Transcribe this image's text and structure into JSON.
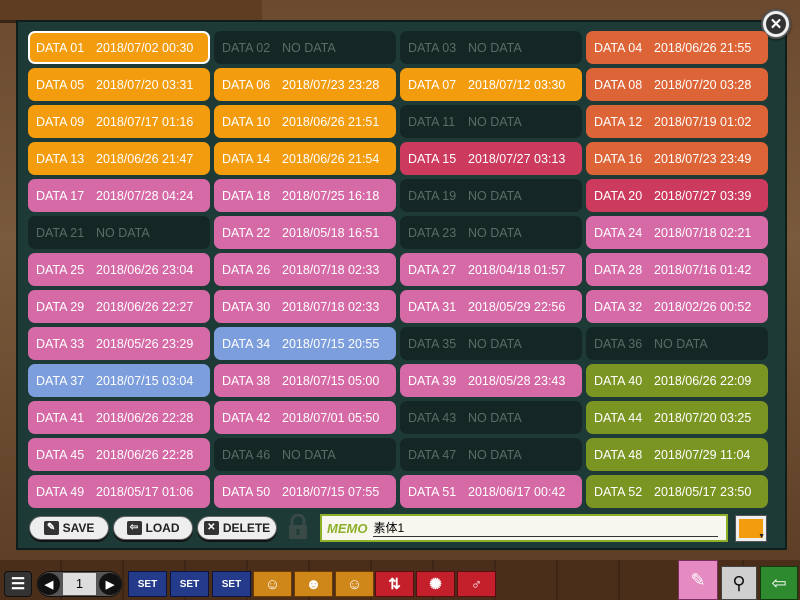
{
  "slots": [
    {
      "label": "DATA 01",
      "value": "2018/07/02  00:30",
      "color": "orange",
      "selected": true
    },
    {
      "label": "DATA 02",
      "value": "NO DATA",
      "color": "empty"
    },
    {
      "label": "DATA 03",
      "value": "NO DATA",
      "color": "empty"
    },
    {
      "label": "DATA 04",
      "value": "2018/06/26  21:55",
      "color": "redorange"
    },
    {
      "label": "DATA 05",
      "value": "2018/07/20  03:31",
      "color": "orange"
    },
    {
      "label": "DATA 06",
      "value": "2018/07/23  23:28",
      "color": "orange"
    },
    {
      "label": "DATA 07",
      "value": "2018/07/12  03:30",
      "color": "orange"
    },
    {
      "label": "DATA 08",
      "value": "2018/07/20  03:28",
      "color": "redorange"
    },
    {
      "label": "DATA 09",
      "value": "2018/07/17  01:16",
      "color": "orange"
    },
    {
      "label": "DATA 10",
      "value": "2018/06/26  21:51",
      "color": "orange"
    },
    {
      "label": "DATA 11",
      "value": "NO DATA",
      "color": "empty"
    },
    {
      "label": "DATA 12",
      "value": "2018/07/19  01:02",
      "color": "redorange"
    },
    {
      "label": "DATA 13",
      "value": "2018/06/26  21:47",
      "color": "orange"
    },
    {
      "label": "DATA 14",
      "value": "2018/06/26  21:54",
      "color": "orange"
    },
    {
      "label": "DATA 15",
      "value": "2018/07/27  03:13",
      "color": "crimson"
    },
    {
      "label": "DATA 16",
      "value": "2018/07/23  23:49",
      "color": "redorange"
    },
    {
      "label": "DATA 17",
      "value": "2018/07/28  04:24",
      "color": "pink"
    },
    {
      "label": "DATA 18",
      "value": "2018/07/25  16:18",
      "color": "pink"
    },
    {
      "label": "DATA 19",
      "value": "NO DATA",
      "color": "empty"
    },
    {
      "label": "DATA 20",
      "value": "2018/07/27  03:39",
      "color": "crimson"
    },
    {
      "label": "DATA 21",
      "value": "NO DATA",
      "color": "empty"
    },
    {
      "label": "DATA 22",
      "value": "2018/05/18  16:51",
      "color": "pink"
    },
    {
      "label": "DATA 23",
      "value": "NO DATA",
      "color": "empty"
    },
    {
      "label": "DATA 24",
      "value": "2018/07/18  02:21",
      "color": "pink"
    },
    {
      "label": "DATA 25",
      "value": "2018/06/26  23:04",
      "color": "pink"
    },
    {
      "label": "DATA 26",
      "value": "2018/07/18  02:33",
      "color": "pink"
    },
    {
      "label": "DATA 27",
      "value": "2018/04/18  01:57",
      "color": "pink"
    },
    {
      "label": "DATA 28",
      "value": "2018/07/16  01:42",
      "color": "pink"
    },
    {
      "label": "DATA 29",
      "value": "2018/06/26  22:27",
      "color": "pink"
    },
    {
      "label": "DATA 30",
      "value": "2018/07/18  02:33",
      "color": "pink"
    },
    {
      "label": "DATA 31",
      "value": "2018/05/29  22:56",
      "color": "pink"
    },
    {
      "label": "DATA 32",
      "value": "2018/02/26  00:52",
      "color": "pink"
    },
    {
      "label": "DATA 33",
      "value": "2018/05/26  23:29",
      "color": "pink"
    },
    {
      "label": "DATA 34",
      "value": "2018/07/15  20:55",
      "color": "blue"
    },
    {
      "label": "DATA 35",
      "value": "NO DATA",
      "color": "empty"
    },
    {
      "label": "DATA 36",
      "value": "NO DATA",
      "color": "empty"
    },
    {
      "label": "DATA 37",
      "value": "2018/07/15  03:04",
      "color": "blue"
    },
    {
      "label": "DATA 38",
      "value": "2018/07/15  05:00",
      "color": "pink"
    },
    {
      "label": "DATA 39",
      "value": "2018/05/28  23:43",
      "color": "pink"
    },
    {
      "label": "DATA 40",
      "value": "2018/06/26  22:09",
      "color": "olive"
    },
    {
      "label": "DATA 41",
      "value": "2018/06/26  22:28",
      "color": "pink"
    },
    {
      "label": "DATA 42",
      "value": "2018/07/01  05:50",
      "color": "pink"
    },
    {
      "label": "DATA 43",
      "value": "NO DATA",
      "color": "empty"
    },
    {
      "label": "DATA 44",
      "value": "2018/07/20  03:25",
      "color": "olive"
    },
    {
      "label": "DATA 45",
      "value": "2018/06/26  22:28",
      "color": "pink"
    },
    {
      "label": "DATA 46",
      "value": "NO DATA",
      "color": "empty"
    },
    {
      "label": "DATA 47",
      "value": "NO DATA",
      "color": "empty"
    },
    {
      "label": "DATA 48",
      "value": "2018/07/29  11:04",
      "color": "olive"
    },
    {
      "label": "DATA 49",
      "value": "2018/05/17  01:06",
      "color": "pink"
    },
    {
      "label": "DATA 50",
      "value": "2018/07/15  07:55",
      "color": "pink"
    },
    {
      "label": "DATA 51",
      "value": "2018/06/17  00:42",
      "color": "pink"
    },
    {
      "label": "DATA 52",
      "value": "2018/05/17  23:50",
      "color": "olive"
    }
  ],
  "toolbar": {
    "save_label": "SAVE",
    "load_label": "LOAD",
    "delete_label": "DELETE"
  },
  "memo": {
    "tag": "MEMO",
    "value": "素体1"
  },
  "color_swatch": "#f39c0e",
  "pager": {
    "page": "1"
  },
  "bottom_buttons": {
    "set1": "SET",
    "set2": "SET",
    "set3": "SET"
  },
  "icons": {
    "close": "close-icon",
    "lock": "lock-icon",
    "menu": "menu-icon",
    "edit": "edit-icon",
    "search": "search-icon",
    "exit": "exit-icon"
  }
}
